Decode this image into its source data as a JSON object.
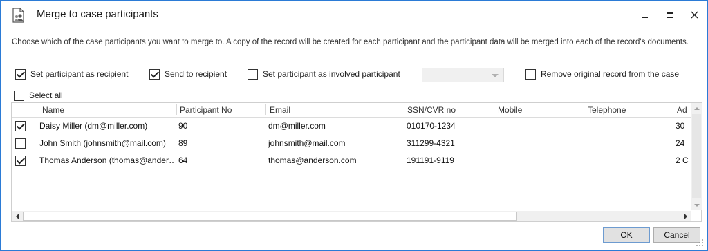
{
  "window": {
    "title": "Merge to case participants",
    "icon": "document-person-icon",
    "accent_color": "#2b7bd6"
  },
  "description": "Choose which of the case participants you want to merge to. A copy of the record will be created for each participant and the participant data will be merged into each of the record's documents.",
  "options": {
    "set_recipient": {
      "label": "Set participant as recipient",
      "checked": true
    },
    "send_to_recipient": {
      "label": "Send to recipient",
      "checked": true
    },
    "set_involved": {
      "label": "Set participant as involved participant",
      "checked": false
    },
    "involved_combo_value": "",
    "remove_original": {
      "label": "Remove original record from the case",
      "checked": false
    }
  },
  "select_all": {
    "label": "Select all",
    "checked": false
  },
  "table": {
    "columns": [
      "Name",
      "Participant No",
      "Email",
      "SSN/CVR no",
      "Mobile",
      "Telephone",
      "Ad"
    ],
    "rows": [
      {
        "checked": true,
        "name": "Daisy Miller (dm@miller.com)",
        "participant_no": "90",
        "email": "dm@miller.com",
        "ssn": "010170-1234",
        "mobile": "",
        "telephone": "",
        "address": "30"
      },
      {
        "checked": false,
        "name": "John Smith (johnsmith@mail.com)",
        "participant_no": "89",
        "email": "johnsmith@mail.com",
        "ssn": "311299-4321",
        "mobile": "",
        "telephone": "",
        "address": "24"
      },
      {
        "checked": true,
        "name": "Thomas Anderson (thomas@ander…",
        "participant_no": "64",
        "email": "thomas@anderson.com",
        "ssn": "191191-9119",
        "mobile": "",
        "telephone": "",
        "address": "2 C"
      }
    ]
  },
  "buttons": {
    "ok": "OK",
    "cancel": "Cancel"
  }
}
